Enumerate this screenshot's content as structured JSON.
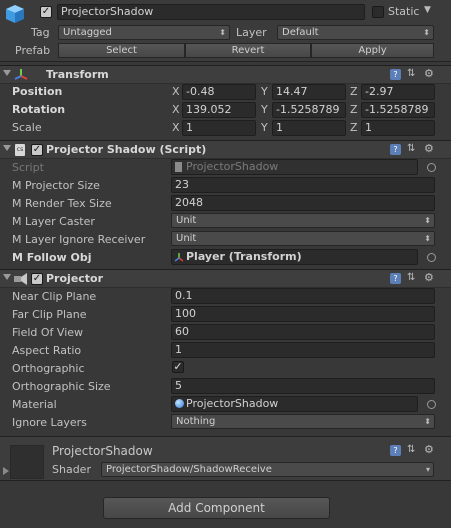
{
  "gameobject": {
    "name": "ProjectorShadow",
    "active": true,
    "static_label": "Static",
    "static_checked": false,
    "tag_label": "Tag",
    "tag_value": "Untagged",
    "layer_label": "Layer",
    "layer_value": "Default",
    "prefab_label": "Prefab",
    "prefab_buttons": [
      "Select",
      "Revert",
      "Apply"
    ]
  },
  "transform": {
    "title": "Transform",
    "rows": [
      {
        "label": "Position",
        "x": "-0.48",
        "y": "14.47",
        "z": "-2.97"
      },
      {
        "label": "Rotation",
        "x": "139.052",
        "y": "-1.5258789",
        "z": "-1.5258789"
      },
      {
        "label": "Scale",
        "x": "1",
        "y": "1",
        "z": "1"
      }
    ],
    "axis": [
      "X",
      "Y",
      "Z"
    ]
  },
  "projector_shadow_script": {
    "title": "Projector Shadow (Script)",
    "enabled": true,
    "script_label": "Script",
    "script_value": "ProjectorShadow",
    "m_projector_size_label": "M Projector Size",
    "m_projector_size": "23",
    "m_render_tex_size_label": "M Render Tex Size",
    "m_render_tex_size": "2048",
    "m_layer_caster_label": "M Layer Caster",
    "m_layer_caster": "Unit",
    "m_layer_ignore_receiver_label": "M Layer Ignore Receiver",
    "m_layer_ignore_receiver": "Unit",
    "m_follow_obj_label": "M Follow Obj",
    "m_follow_obj": "Player (Transform)"
  },
  "projector": {
    "title": "Projector",
    "enabled": true,
    "near_clip_label": "Near Clip Plane",
    "near_clip": "0.1",
    "far_clip_label": "Far Clip Plane",
    "far_clip": "100",
    "fov_label": "Field Of View",
    "fov": "60",
    "aspect_label": "Aspect Ratio",
    "aspect": "1",
    "ortho_label": "Orthographic",
    "ortho": true,
    "ortho_size_label": "Orthographic Size",
    "ortho_size": "5",
    "material_label": "Material",
    "material": "ProjectorShadow",
    "ignore_layers_label": "Ignore Layers",
    "ignore_layers": "Nothing"
  },
  "material_preview": {
    "name": "ProjectorShadow",
    "shader_label": "Shader",
    "shader": "ProjectorShadow/ShadowReceive"
  },
  "add_component_label": "Add Component",
  "colors": {
    "background": "#383838",
    "header": "#3e3e3e",
    "field": "#2b2b2b"
  }
}
